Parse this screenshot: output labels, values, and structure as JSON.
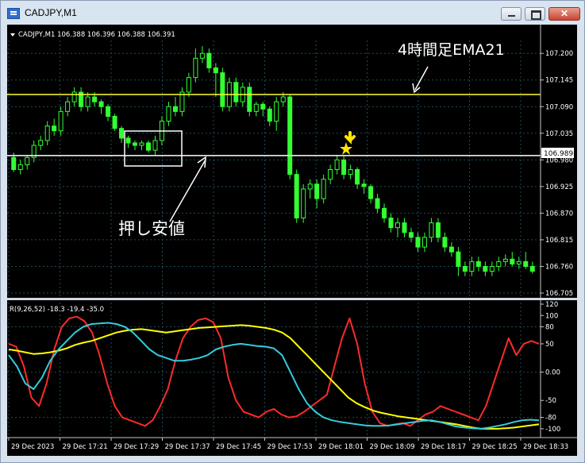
{
  "window": {
    "title": "CADJPY,M1"
  },
  "colors": {
    "bg": "#000000",
    "grid": "#1f4a5a",
    "candle": "#33ff33",
    "ema": "#ffff33",
    "level": "#ffffff",
    "rci_red": "#ff2a2a",
    "rci_yellow": "#ffff00",
    "rci_cyan": "#33ccdd",
    "arrow": "#ffe600"
  },
  "main_panel": {
    "header": "CADJPY,M1  106.388 106.396 106.388 106.391",
    "price_labels": [
      "107.200",
      "107.145",
      "107.090",
      "107.035",
      "106.980",
      "106.925",
      "106.870",
      "106.815",
      "106.760",
      "106.705"
    ],
    "current_price": "106.989",
    "annotation_ema": "4時間足EMA21",
    "annotation_pullback": "押し安値"
  },
  "sub_panel": {
    "header": "R(9,26,52) -18.3 -19.4 -35.0",
    "scale_labels": [
      "120",
      "100",
      "80",
      "50",
      "0.00",
      "-50",
      "-80",
      "-100"
    ]
  },
  "time_labels": [
    "29 Dec 2023",
    "29 Dec 17:21",
    "29 Dec 17:29",
    "29 Dec 17:37",
    "29 Dec 17:45",
    "29 Dec 17:53",
    "29 Dec 18:01",
    "29 Dec 18:09",
    "29 Dec 18:17",
    "29 Dec 18:25",
    "29 Dec 18:33"
  ],
  "chart_data": [
    {
      "type": "candlestick",
      "symbol": "CADJPY",
      "timeframe": "M1",
      "ylim": [
        106.705,
        107.22
      ],
      "ema_level": 107.115,
      "horizontal_level": 106.989,
      "candles": [
        [
          106.985,
          106.96,
          106.995,
          106.955
        ],
        [
          106.96,
          106.97,
          106.98,
          106.95
        ],
        [
          106.97,
          106.985,
          106.99,
          106.96
        ],
        [
          106.985,
          107.01,
          107.02,
          106.975
        ],
        [
          107.01,
          107.02,
          107.03,
          107.0
        ],
        [
          107.02,
          107.05,
          107.06,
          107.01
        ],
        [
          107.05,
          107.04,
          107.065,
          107.03
        ],
        [
          107.04,
          107.08,
          107.09,
          107.03
        ],
        [
          107.08,
          107.1,
          107.11,
          107.07
        ],
        [
          107.1,
          107.12,
          107.13,
          107.09
        ],
        [
          107.12,
          107.09,
          107.13,
          107.08
        ],
        [
          107.09,
          107.11,
          107.12,
          107.08
        ],
        [
          107.11,
          107.1,
          107.12,
          107.09
        ],
        [
          107.1,
          107.09,
          107.105,
          107.075
        ],
        [
          107.09,
          107.07,
          107.095,
          107.06
        ],
        [
          107.07,
          107.045,
          107.075,
          107.04
        ],
        [
          107.045,
          107.025,
          107.05,
          107.015
        ],
        [
          107.025,
          107.015,
          107.03,
          107.005
        ],
        [
          107.015,
          107.01,
          107.02,
          107.0
        ],
        [
          107.01,
          107.015,
          107.02,
          107.0
        ],
        [
          107.015,
          107.0,
          107.02,
          106.995
        ],
        [
          107.0,
          107.02,
          107.03,
          106.99
        ],
        [
          107.02,
          107.06,
          107.07,
          107.01
        ],
        [
          107.06,
          107.09,
          107.1,
          107.05
        ],
        [
          107.09,
          107.08,
          107.11,
          107.07
        ],
        [
          107.08,
          107.12,
          107.13,
          107.07
        ],
        [
          107.12,
          107.15,
          107.16,
          107.11
        ],
        [
          107.15,
          107.19,
          107.21,
          107.14
        ],
        [
          107.19,
          107.2,
          107.215,
          107.18
        ],
        [
          107.2,
          107.17,
          107.21,
          107.16
        ],
        [
          107.17,
          107.16,
          107.18,
          107.11
        ],
        [
          107.16,
          107.09,
          107.17,
          107.08
        ],
        [
          107.09,
          107.14,
          107.15,
          107.08
        ],
        [
          107.14,
          107.1,
          107.15,
          107.09
        ],
        [
          107.1,
          107.13,
          107.14,
          107.09
        ],
        [
          107.13,
          107.08,
          107.14,
          107.07
        ],
        [
          107.08,
          107.095,
          107.1,
          107.07
        ],
        [
          107.095,
          107.085,
          107.1,
          107.07
        ],
        [
          107.085,
          107.06,
          107.09,
          107.05
        ],
        [
          107.06,
          107.1,
          107.11,
          107.04
        ],
        [
          107.1,
          107.11,
          107.12,
          107.09
        ],
        [
          107.11,
          106.95,
          107.115,
          106.94
        ],
        [
          106.95,
          106.86,
          106.96,
          106.85
        ],
        [
          106.86,
          106.92,
          106.93,
          106.85
        ],
        [
          106.92,
          106.93,
          106.94,
          106.9
        ],
        [
          106.93,
          106.9,
          106.94,
          106.88
        ],
        [
          106.9,
          106.94,
          106.95,
          106.89
        ],
        [
          106.94,
          106.96,
          106.97,
          106.93
        ],
        [
          106.96,
          106.98,
          106.99,
          106.95
        ],
        [
          106.98,
          106.95,
          106.99,
          106.94
        ],
        [
          106.95,
          106.96,
          106.97,
          106.94
        ],
        [
          106.96,
          106.93,
          106.965,
          106.92
        ],
        [
          106.93,
          106.925,
          106.94,
          106.91
        ],
        [
          106.925,
          106.9,
          106.93,
          106.89
        ],
        [
          106.9,
          106.88,
          106.91,
          106.87
        ],
        [
          106.88,
          106.86,
          106.89,
          106.85
        ],
        [
          106.86,
          106.84,
          106.87,
          106.83
        ],
        [
          106.84,
          106.85,
          106.86,
          106.82
        ],
        [
          106.85,
          106.83,
          106.86,
          106.82
        ],
        [
          106.83,
          106.82,
          106.84,
          106.81
        ],
        [
          106.82,
          106.8,
          106.83,
          106.79
        ],
        [
          106.8,
          106.82,
          106.83,
          106.79
        ],
        [
          106.82,
          106.85,
          106.86,
          106.81
        ],
        [
          106.85,
          106.82,
          106.86,
          106.81
        ],
        [
          106.82,
          106.8,
          106.83,
          106.79
        ],
        [
          106.8,
          106.79,
          106.81,
          106.78
        ],
        [
          106.79,
          106.76,
          106.8,
          106.74
        ],
        [
          106.76,
          106.75,
          106.77,
          106.74
        ],
        [
          106.75,
          106.77,
          106.78,
          106.74
        ],
        [
          106.77,
          106.76,
          106.78,
          106.75
        ],
        [
          106.76,
          106.75,
          106.77,
          106.74
        ],
        [
          106.75,
          106.76,
          106.77,
          106.74
        ],
        [
          106.76,
          106.77,
          106.78,
          106.75
        ],
        [
          106.77,
          106.775,
          106.785,
          106.76
        ],
        [
          106.775,
          106.765,
          106.79,
          106.76
        ],
        [
          106.765,
          106.77,
          106.78,
          106.755
        ],
        [
          106.77,
          106.76,
          106.79,
          106.755
        ],
        [
          106.76,
          106.75,
          106.77,
          106.745
        ]
      ]
    },
    {
      "type": "line",
      "name": "R(9,26,52)",
      "ylim": [
        -110,
        120
      ],
      "series": [
        {
          "color": "#ff2a2a",
          "values": [
            50,
            45,
            10,
            -45,
            -60,
            -20,
            40,
            80,
            95,
            98,
            90,
            70,
            30,
            -20,
            -60,
            -80,
            -85,
            -90,
            -95,
            -85,
            -60,
            -30,
            20,
            60,
            80,
            92,
            95,
            88,
            60,
            -10,
            -50,
            -70,
            -75,
            -80,
            -70,
            -65,
            -75,
            -80,
            -78,
            -70,
            -60,
            -50,
            -40,
            10,
            60,
            95,
            50,
            -20,
            -70,
            -90,
            -95,
            -92,
            -90,
            -95,
            -85,
            -75,
            -70,
            -60,
            -65,
            -70,
            -75,
            -80,
            -85,
            -60,
            -20,
            20,
            60,
            30,
            50,
            55,
            50
          ]
        },
        {
          "color": "#ffff00",
          "values": [
            40,
            38,
            35,
            32,
            33,
            35,
            38,
            42,
            48,
            52,
            55,
            60,
            65,
            70,
            73,
            75,
            76,
            74,
            72,
            70,
            72,
            74,
            76,
            78,
            79,
            80,
            81,
            82,
            83,
            82,
            80,
            78,
            75,
            70,
            60,
            45,
            30,
            15,
            0,
            -15,
            -30,
            -45,
            -55,
            -62,
            -68,
            -72,
            -75,
            -78,
            -80,
            -82,
            -84,
            -86,
            -88,
            -90,
            -92,
            -95,
            -98,
            -100,
            -100,
            -100,
            -99,
            -98,
            -96,
            -94,
            -92
          ]
        },
        {
          "color": "#33ccdd",
          "values": [
            30,
            10,
            -20,
            -30,
            -10,
            20,
            40,
            55,
            70,
            80,
            85,
            86,
            87,
            85,
            80,
            70,
            55,
            40,
            30,
            25,
            20,
            20,
            22,
            25,
            30,
            40,
            45,
            48,
            50,
            48,
            46,
            45,
            42,
            30,
            0,
            -30,
            -55,
            -70,
            -80,
            -85,
            -88,
            -90,
            -92,
            -94,
            -95,
            -95,
            -94,
            -92,
            -90,
            -88,
            -86,
            -85,
            -88,
            -92,
            -96,
            -98,
            -99,
            -100,
            -98,
            -95,
            -92,
            -88,
            -85,
            -84,
            -85
          ]
        }
      ]
    }
  ]
}
